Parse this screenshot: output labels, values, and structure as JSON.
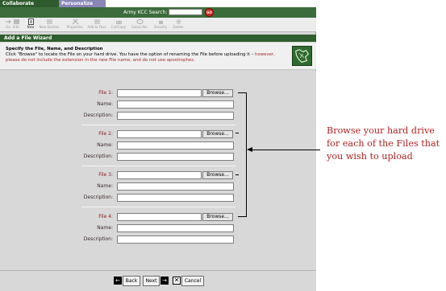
{
  "tabs": [
    {
      "label": "Collaborate"
    },
    {
      "label": "Personalize"
    }
  ],
  "search": {
    "label": "Army KCC Search:",
    "value": "",
    "go_label": "GO"
  },
  "toolbar": [
    {
      "label": "Go",
      "icon": "go-icon",
      "enabled": false
    },
    {
      "label": "Edit",
      "icon": "edit-icon",
      "enabled": false
    },
    {
      "label": "New",
      "icon": "new-icon",
      "enabled": true
    },
    {
      "label": "New Section",
      "icon": "new-section-icon",
      "enabled": false
    },
    {
      "label": "Properties",
      "icon": "properties-icon",
      "enabled": false
    },
    {
      "label": "Add to Favs",
      "icon": "add-to-favs-icon",
      "enabled": false
    },
    {
      "label": "Cut/Copy",
      "icon": "cut-copy-icon",
      "enabled": false
    },
    {
      "label": "Subscribe",
      "icon": "subscribe-icon",
      "enabled": false
    },
    {
      "label": "Security",
      "icon": "security-icon",
      "enabled": false
    },
    {
      "label": "Delete",
      "icon": "delete-icon",
      "enabled": false
    }
  ],
  "wizard": {
    "title": "Add a File Wizard",
    "heading": "Specify the File, Name, and Description",
    "instructions": "Click \"Browse\" to locate the File on your hard drive.  You have the option of renaming the File before uploading it – ",
    "warning": "however, please do not include the extension in the new File name, and do not use apostrophes."
  },
  "files": [
    {
      "file_label": "File 1:",
      "name_label": "Name:",
      "desc_label": "Description:",
      "file_value": "",
      "name_value": "",
      "desc_value": "",
      "browse_label": "Browse..."
    },
    {
      "file_label": "File 2:",
      "name_label": "Name:",
      "desc_label": "Description:",
      "file_value": "",
      "name_value": "",
      "desc_value": "",
      "browse_label": "Browse..."
    },
    {
      "file_label": "File 3:",
      "name_label": "Name:",
      "desc_label": "Description:",
      "file_value": "",
      "name_value": "",
      "desc_value": "",
      "browse_label": "Browse..."
    },
    {
      "file_label": "File 4:",
      "name_label": "Name:",
      "desc_label": "Description:",
      "file_value": "",
      "name_value": "",
      "desc_value": "",
      "browse_label": "Browse..."
    }
  ],
  "callout": {
    "text": "Browse your hard drive for each of the Files that you wish to upload"
  },
  "nav": {
    "back_label": "Back",
    "next_label": "Next",
    "cancel_label": "Cancel"
  },
  "colors": {
    "brand_green": "#2f5e2f",
    "label_red": "#8b1a1a",
    "callout_red": "#b02222"
  }
}
